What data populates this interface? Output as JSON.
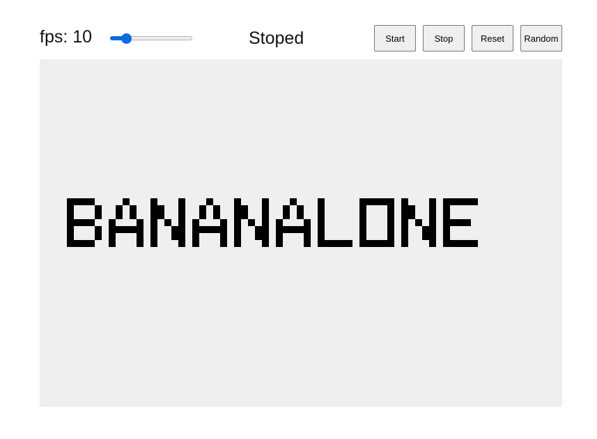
{
  "controls": {
    "fps_prefix": "fps: ",
    "fps_value": "10",
    "fps_display": "fps: 10",
    "fps_min": 1,
    "fps_max": 60,
    "status": "Stoped",
    "buttons": {
      "start": "Start",
      "stop": "Stop",
      "reset": "Reset",
      "random": "Random"
    }
  },
  "colors": {
    "accent": "#0b6be0",
    "canvas_bg": "#efefef",
    "cell": "#000000"
  },
  "board": {
    "pattern_text": "BANANALONE"
  }
}
